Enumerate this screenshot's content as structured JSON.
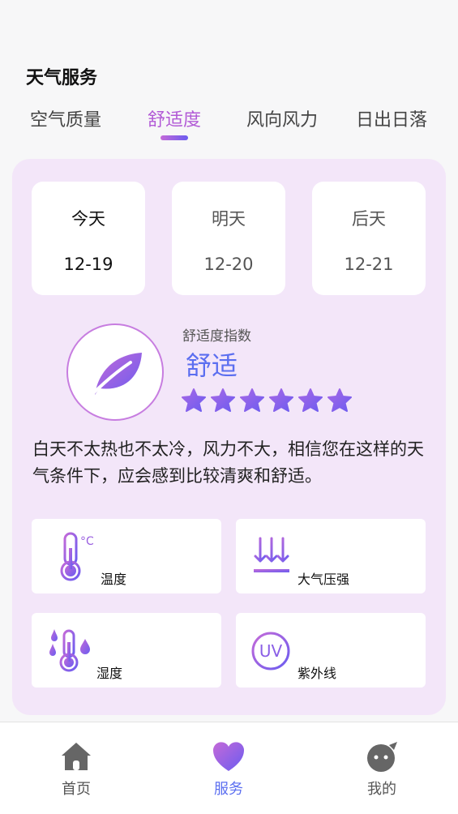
{
  "header": {
    "title": "天气服务"
  },
  "tabs": [
    {
      "label": "空气质量",
      "active": false
    },
    {
      "label": "舒适度",
      "active": true
    },
    {
      "label": "风向风力",
      "active": false
    },
    {
      "label": "日出日落",
      "active": false
    }
  ],
  "days": [
    {
      "name": "今天",
      "date": "12-19",
      "selected": true
    },
    {
      "name": "明天",
      "date": "12-20",
      "selected": false
    },
    {
      "name": "后天",
      "date": "12-21",
      "selected": false
    }
  ],
  "comfort": {
    "index_label": "舒适度指数",
    "value": "舒适",
    "stars": 6,
    "description": "白天不太热也不太冷，风力不大，相信您在这样的天气条件下，应会感到比较清爽和舒适。"
  },
  "metrics": [
    {
      "label": "温度",
      "icon": "thermometer-celsius-icon"
    },
    {
      "label": "大气压强",
      "icon": "pressure-arrows-icon"
    },
    {
      "label": "湿度",
      "icon": "humidity-thermometer-icon"
    },
    {
      "label": "紫外线",
      "icon": "uv-icon"
    }
  ],
  "bottom_nav": [
    {
      "label": "首页",
      "icon": "home-icon",
      "active": false
    },
    {
      "label": "服务",
      "icon": "heart-icon",
      "active": true
    },
    {
      "label": "我的",
      "icon": "profile-icon",
      "active": false
    }
  ],
  "colors": {
    "accent_purple": "#b25ad6",
    "accent_blue": "#5b6ef0",
    "card_bg": "#f3e6f9"
  }
}
